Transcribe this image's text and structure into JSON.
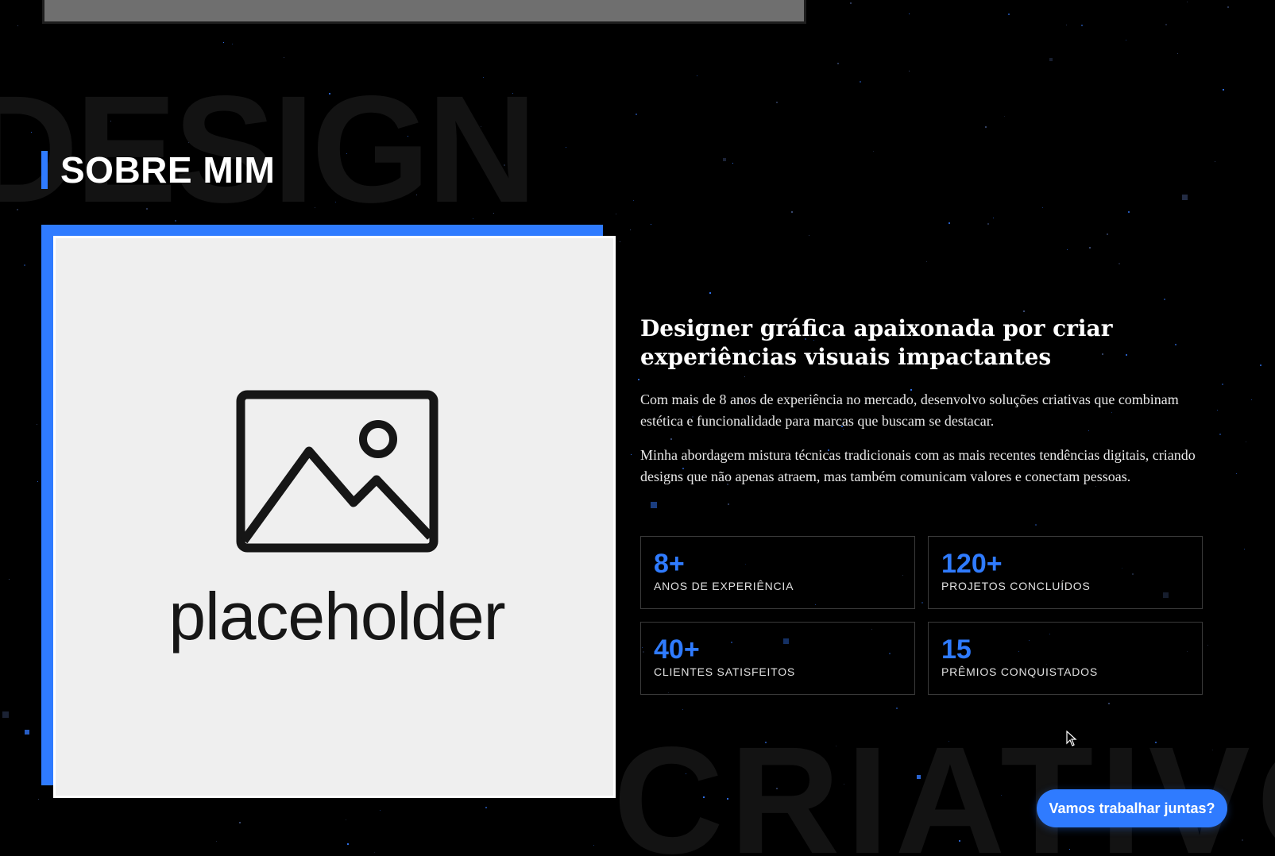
{
  "background_words": {
    "top": "DESIGN",
    "bottom": "CRIATIVO"
  },
  "section": {
    "title": "SOBRE MIM"
  },
  "photo": {
    "placeholder_text": "placeholder",
    "icon": "image-placeholder-icon"
  },
  "about": {
    "heading": "Designer gráfica apaixonada por criar experiências visuais impactantes",
    "paragraphs": [
      "Com mais de 8 anos de experiência no mercado, desenvolvo soluções criativas que combinam estética e funcionalidade para marcas que buscam se destacar.",
      "Minha abordagem mistura técnicas tradicionais com as mais recentes tendências digitais, criando designs que não apenas atraem, mas também comunicam valores e conectam pessoas."
    ]
  },
  "stats": [
    {
      "value": "8+",
      "label": "ANOS DE EXPERIÊNCIA"
    },
    {
      "value": "120+",
      "label": "PROJETOS CONCLUÍDOS"
    },
    {
      "value": "40+",
      "label": "CLIENTES SATISFEITOS"
    },
    {
      "value": "15",
      "label": "PRÊMIOS CONQUISTADOS"
    }
  ],
  "cta": {
    "label": "Vamos trabalhar juntas?"
  },
  "colors": {
    "accent": "#2f7bff",
    "background": "#000000",
    "text": "#ffffff"
  }
}
